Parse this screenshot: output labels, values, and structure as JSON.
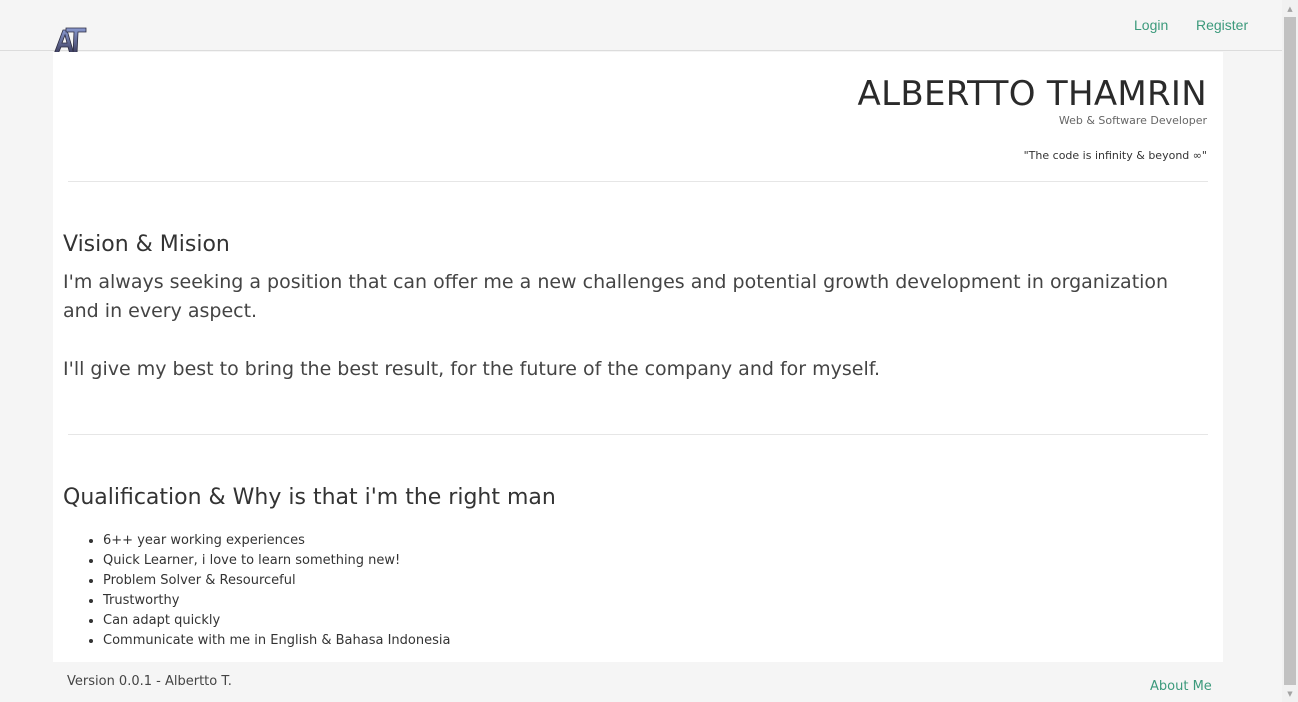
{
  "nav": {
    "logo_text": "AT",
    "login": "Login",
    "register": "Register"
  },
  "hero": {
    "name": "ALBERTTO THAMRIN",
    "role": "Web & Software Developer",
    "quote": "\"The code is infinity & beyond ∞\""
  },
  "vision": {
    "title": "Vision & Mision",
    "paragraphs": [
      "I'm always seeking a position that can offer me a new challenges and potential growth development in organization and in every aspect.",
      "I'll give my best to bring the best result, for the future of the company and for myself."
    ]
  },
  "qualification": {
    "title": "Qualification & Why is that i'm the right man",
    "items": [
      "6++ year working experiences",
      "Quick Learner, i love to learn something new!",
      "Problem Solver & Resourceful",
      "Trustworthy",
      "Can adapt quickly",
      "Communicate with me in English & Bahasa Indonesia"
    ]
  },
  "footer": {
    "version": "Version 0.0.1 - Albertto T.",
    "about": "About Me"
  },
  "colors": {
    "accent": "#3c9a7c",
    "background": "#f5f5f5",
    "card": "#ffffff"
  }
}
